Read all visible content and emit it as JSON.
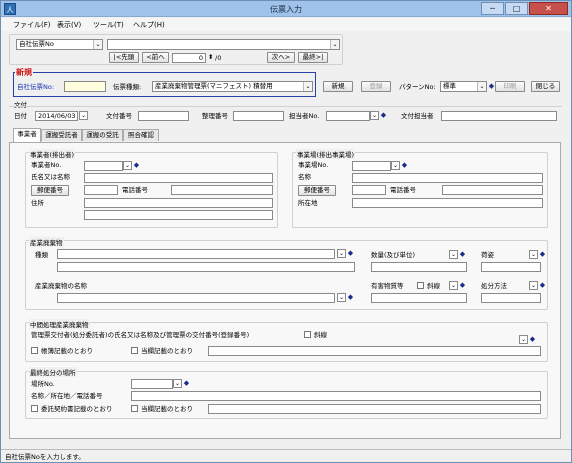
{
  "window": {
    "title": "伝票入力",
    "icon": "人"
  },
  "titlebar_buttons": {
    "min": "─",
    "max": "□",
    "close": "✕"
  },
  "menu": [
    {
      "label": "ファイル(F)"
    },
    {
      "label": "表示(V)"
    },
    {
      "label": "ツール(T)"
    },
    {
      "label": "ヘルプ(H)"
    }
  ],
  "search": {
    "key_select": "自社伝票No",
    "first": "|<先頭",
    "prev": "<前へ",
    "page_value": "0",
    "page_total": "/0",
    "next": "次へ>",
    "last": "最終>|"
  },
  "header": {
    "new_badge": "新規",
    "doc_no_label": "自社伝票No:",
    "doc_type_label": "伝票種類:",
    "doc_type_value": "産業廃棄物管理票(マニフェスト) 積替用",
    "new_btn": "新規",
    "register_btn": "登録",
    "pattern_label": "パターンNo:",
    "pattern_value": "標準",
    "print_btn": "印刷",
    "close_btn": "閉じる"
  },
  "bunfu": {
    "section": "文付",
    "date_label": "日付",
    "date_value": "2014/06/03",
    "doc_no_label": "文付番号",
    "seiri_label": "整理番号",
    "tanto_no_label": "担当者No.",
    "tanto_label": "文付担当者"
  },
  "tabs": [
    {
      "label": "事業者"
    },
    {
      "label": "運搬受託者"
    },
    {
      "label": "運搬の受託"
    },
    {
      "label": "照合確認"
    }
  ],
  "jigyosha": {
    "title": "事業者(排出者)",
    "no": "事業者No.",
    "name": "氏名又は名称",
    "postal": "郵便番号",
    "tel": "電話番号",
    "address": "住所"
  },
  "jigyojo": {
    "title": "事業場(排出事業場)",
    "no": "事業場No.",
    "name": "名称",
    "postal": "郵便番号",
    "tel": "電話番号",
    "address": "所在地"
  },
  "waste": {
    "title": "産業廃棄物",
    "kind": "種類",
    "qty": "数量(及び単位)",
    "shape": "荷姿",
    "name": "産業廃棄物の名称",
    "hazard": "有害物質等",
    "oblique": "斜線",
    "disposal": "処分方法"
  },
  "mid": {
    "title": "中間処理産業廃棄物",
    "text": "管理票交付者(処分委託者)の氏名又は名称及び管理票の交付番号(登録番号)",
    "oblique": "斜線",
    "ledger": "帳簿記載のとおり",
    "contract": "当欄記載のとおり"
  },
  "final": {
    "title": "最終処分の場所",
    "place_no": "場所No.",
    "name_addr_tel": "名称／所在地／電話番号",
    "contract": "委託契約書記載のとおり",
    "this_field": "当欄記載のとおり"
  },
  "status": "自社伝票Noを入力します。"
}
